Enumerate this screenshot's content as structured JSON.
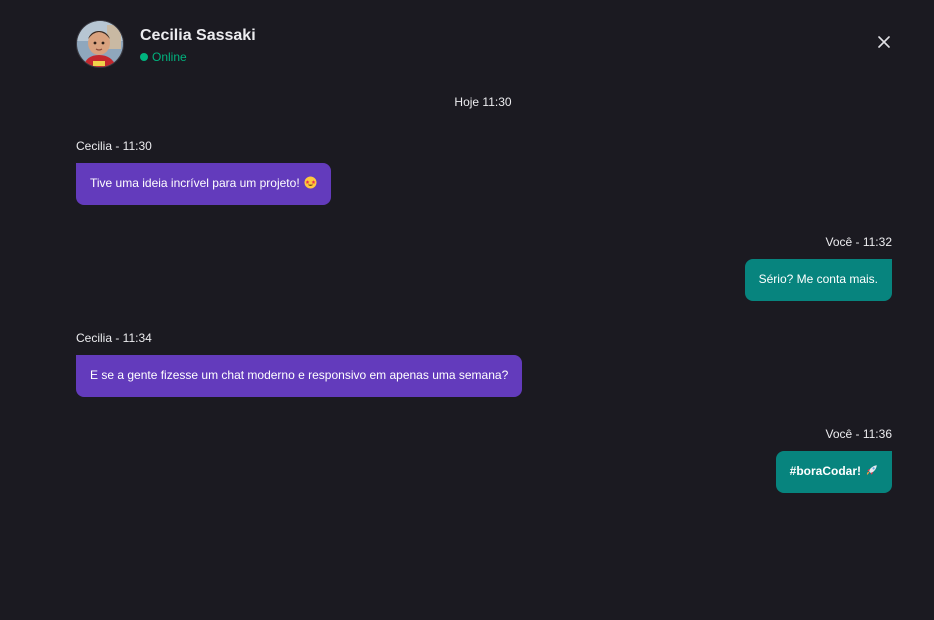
{
  "contact": {
    "name": "Cecilia Sassaki",
    "status": "Online"
  },
  "day_label": "Hoje 11:30",
  "messages": [
    {
      "meta": "Cecilia - 11:30",
      "text": "Tive uma ideia incrível para um projeto!",
      "emoji": "star-struck-emoji"
    },
    {
      "meta": "Você - 11:32",
      "text": "Sério? Me conta mais."
    },
    {
      "meta": "Cecilia - 11:34",
      "text": "E se a gente fizesse um chat moderno e responsivo em apenas uma semana?"
    },
    {
      "meta": "Você - 11:36",
      "text": "#boraCodar!",
      "emoji": "rocket-emoji"
    }
  ],
  "colors": {
    "background": "#1b1a21",
    "incoming_bubble": "#633bbc",
    "outgoing_bubble": "#07847e",
    "online": "#00b37e"
  }
}
